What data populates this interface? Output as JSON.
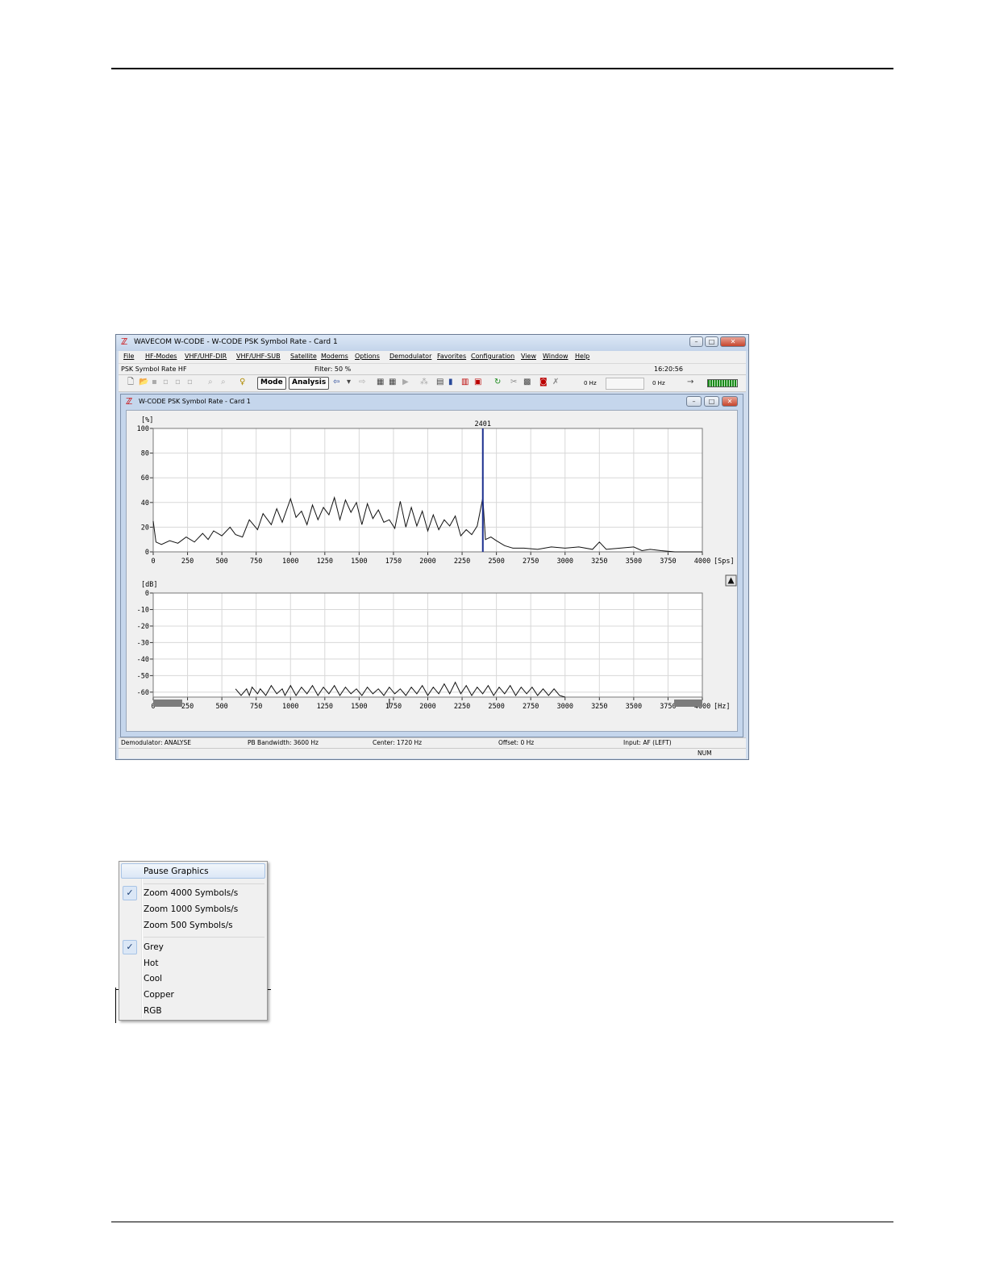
{
  "window": {
    "title": "WAVECOM W-CODE - W-CODE PSK Symbol Rate  - Card 1",
    "menu": [
      "File",
      "HF-Modes",
      "VHF/UHF-DIR",
      "VHF/UHF-SUB",
      "Satellite",
      "Modems",
      "Options",
      "Demodulator",
      "Favorites",
      "Configuration",
      "View",
      "Window",
      "Help"
    ],
    "info": {
      "mode": "PSK Symbol Rate HF",
      "filter": "Filter: 50 %",
      "time": "16:20:56"
    },
    "toolbar": {
      "mode_button": "Mode",
      "analysis_button": "Analysis",
      "freq1": "0 Hz",
      "freq2": "0 Hz"
    },
    "status": {
      "demodulator": "Demodulator: ANALYSE",
      "bandwidth": "PB Bandwidth: 3600 Hz",
      "center": "Center: 1720 Hz",
      "offset": "Offset: 0 Hz",
      "input": "Input: AF (LEFT)",
      "num": "NUM"
    }
  },
  "child_window": {
    "title": "W-CODE PSK Symbol Rate  - Card 1"
  },
  "chart_data": [
    {
      "type": "line",
      "ylabel": "[%]",
      "xunit": "[Sps]",
      "ylim": [
        0,
        100
      ],
      "xlim": [
        0,
        4000
      ],
      "yticks": [
        "0",
        "20",
        "40",
        "60",
        "80",
        "100"
      ],
      "xticks": [
        "0",
        "250",
        "500",
        "750",
        "1000",
        "1250",
        "1500",
        "1750",
        "2000",
        "2250",
        "2500",
        "2750",
        "3000",
        "3250",
        "3500",
        "3750",
        "4000"
      ],
      "marker": {
        "x": 2401,
        "label": "2401"
      },
      "grid": true,
      "x": [
        0,
        20,
        60,
        120,
        180,
        240,
        300,
        360,
        400,
        440,
        500,
        560,
        600,
        650,
        700,
        760,
        800,
        860,
        900,
        940,
        1000,
        1040,
        1080,
        1120,
        1160,
        1200,
        1240,
        1280,
        1320,
        1360,
        1400,
        1440,
        1480,
        1520,
        1560,
        1600,
        1640,
        1680,
        1720,
        1760,
        1800,
        1840,
        1880,
        1920,
        1960,
        2000,
        2040,
        2080,
        2120,
        2160,
        2200,
        2240,
        2280,
        2320,
        2360,
        2401,
        2420,
        2460,
        2500,
        2560,
        2620,
        2700,
        2800,
        2900,
        3000,
        3100,
        3200,
        3250,
        3300,
        3400,
        3500,
        3560,
        3620,
        3700,
        3800,
        3900,
        4000
      ],
      "y": [
        25,
        8,
        6,
        9,
        7,
        12,
        8,
        15,
        10,
        17,
        13,
        20,
        14,
        12,
        26,
        18,
        31,
        22,
        35,
        24,
        43,
        28,
        33,
        22,
        38,
        26,
        36,
        30,
        44,
        26,
        42,
        32,
        40,
        22,
        39,
        27,
        34,
        24,
        26,
        19,
        41,
        20,
        36,
        21,
        33,
        17,
        30,
        18,
        26,
        21,
        29,
        13,
        18,
        14,
        21,
        44,
        10,
        12,
        9,
        5,
        3,
        3,
        2,
        4,
        3,
        4,
        2,
        8,
        2,
        3,
        4,
        1,
        2,
        1,
        0,
        0,
        0
      ]
    },
    {
      "type": "line",
      "ylabel": "[dB]",
      "xunit": "[Hz]",
      "ylim": [
        -63,
        0
      ],
      "xlim": [
        0,
        4000
      ],
      "yticks": [
        "0",
        "-10",
        "-20",
        "-30",
        "-40",
        "-50",
        "-60"
      ],
      "xticks": [
        "0",
        "250",
        "500",
        "750",
        "1000",
        "1250",
        "1500",
        "1750",
        "2000",
        "2250",
        "2500",
        "2750",
        "3000",
        "3250",
        "3500",
        "3750",
        "4000"
      ],
      "grid": true,
      "x": [
        600,
        640,
        680,
        700,
        720,
        760,
        780,
        820,
        860,
        900,
        940,
        960,
        1000,
        1040,
        1080,
        1120,
        1160,
        1200,
        1240,
        1280,
        1320,
        1360,
        1400,
        1440,
        1480,
        1520,
        1560,
        1600,
        1640,
        1680,
        1720,
        1760,
        1800,
        1840,
        1880,
        1920,
        1960,
        2000,
        2040,
        2080,
        2120,
        2160,
        2200,
        2240,
        2280,
        2320,
        2360,
        2400,
        2440,
        2480,
        2520,
        2560,
        2600,
        2640,
        2680,
        2720,
        2760,
        2800,
        2840,
        2880,
        2920,
        2960,
        3000
      ],
      "y": [
        -58,
        -62,
        -58,
        -62,
        -57,
        -61,
        -58,
        -62,
        -56,
        -61,
        -58,
        -62,
        -56,
        -62,
        -57,
        -61,
        -56,
        -62,
        -57,
        -61,
        -56,
        -62,
        -57,
        -61,
        -58,
        -62,
        -57,
        -61,
        -58,
        -62,
        -57,
        -61,
        -58,
        -62,
        -57,
        -61,
        -56,
        -62,
        -57,
        -61,
        -55,
        -61,
        -54,
        -61,
        -56,
        -62,
        -57,
        -61,
        -56,
        -62,
        -57,
        -61,
        -56,
        -62,
        -57,
        -61,
        -57,
        -62,
        -58,
        -62,
        -58,
        -62,
        -63
      ]
    }
  ],
  "context_menu": {
    "pause": "Pause Graphics",
    "zoom": [
      {
        "label": "Zoom 4000 Symbols/s",
        "checked": true
      },
      {
        "label": "Zoom 1000 Symbols/s",
        "checked": false
      },
      {
        "label": "Zoom 500  Symbols/s",
        "checked": false
      }
    ],
    "colormaps": [
      {
        "label": "Grey",
        "checked": true
      },
      {
        "label": "Hot",
        "checked": false
      },
      {
        "label": "Cool",
        "checked": false
      },
      {
        "label": "Copper",
        "checked": false
      },
      {
        "label": "RGB",
        "checked": false
      }
    ]
  }
}
